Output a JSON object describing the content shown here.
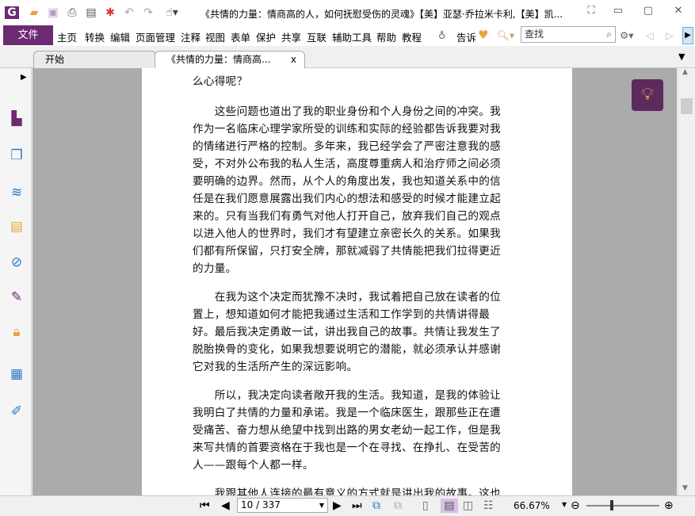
{
  "window": {
    "title": "《共情的力量：情商高的人，如何抚慰受伤的灵魂》【美】亚瑟·乔拉米卡利,【美】凯..."
  },
  "menu": {
    "file": "文件",
    "items": [
      "主页",
      "转换",
      "编辑",
      "页面管理",
      "注释",
      "视图",
      "表单",
      "保护",
      "共享",
      "互联",
      "辅助工具",
      "帮助",
      "教程"
    ],
    "tell": "告诉",
    "search_placeholder": "查找"
  },
  "tabs": [
    {
      "label": "开始"
    },
    {
      "label": "《共情的力量：情商高...",
      "close": "x"
    }
  ],
  "document": {
    "lines": [
      "么心得呢？",
      "　　这些问题也道出了我的职业身份和个人身份之间的冲突。我",
      "作为一名临床心理学家所受的训练和实际的经验都告诉我要对我",
      "的情绪进行严格的控制。多年来，我已经学会了严密注意我的感",
      "受，不对外公布我的私人生活，高度尊重病人和治疗师之间必须",
      "要明确的边界。然而，从个人的角度出发，我也知道关系中的信",
      "任是在我们愿意展露出我们内心的想法和感受的时候才能建立起",
      "来的。只有当我们有勇气对他人打开自己，放弃我们自己的观点",
      "以进入他人的世界时，我们才有望建立亲密长久的关系。如果我",
      "们都有所保留，只打安全牌，那就减弱了共情能把我们拉得更近",
      "的力量。",
      "　　在我为这个决定而犹豫不决时，我试着把自己放在读者的位",
      "置上，想知道如何才能把我通过生活和工作学到的共情讲得最",
      "好。最后我决定勇敢一试，讲出我自己的故事。共情让我发生了",
      "脱胎换骨的变化，如果我想要说明它的潜能，就必须承认并感谢",
      "它对我的生活所产生的深远影响。",
      "　　所以，我决定向读者敞开我的生活。我知道，是我的体验让",
      "我明白了共情的力量和承诺。我是一个临床医生，跟那些正在遭",
      "受痛苦、奋力想从绝望中找到出路的男女老幼一起工作，但是我",
      "来写共情的首要资格在于我也是一个在寻找、在挣扎、在受苦的",
      "人——跟每个人都一样。",
      "　　我跟其他人连接的最有意义的方式就是讲出我的故事。这也"
    ]
  },
  "navigation": {
    "page_display": "10 / 337",
    "current_page": 10,
    "total_pages": 337,
    "zoom": "66.67%"
  },
  "colors": {
    "accent": "#6c2a73",
    "viewer_bg": "#ababab"
  }
}
